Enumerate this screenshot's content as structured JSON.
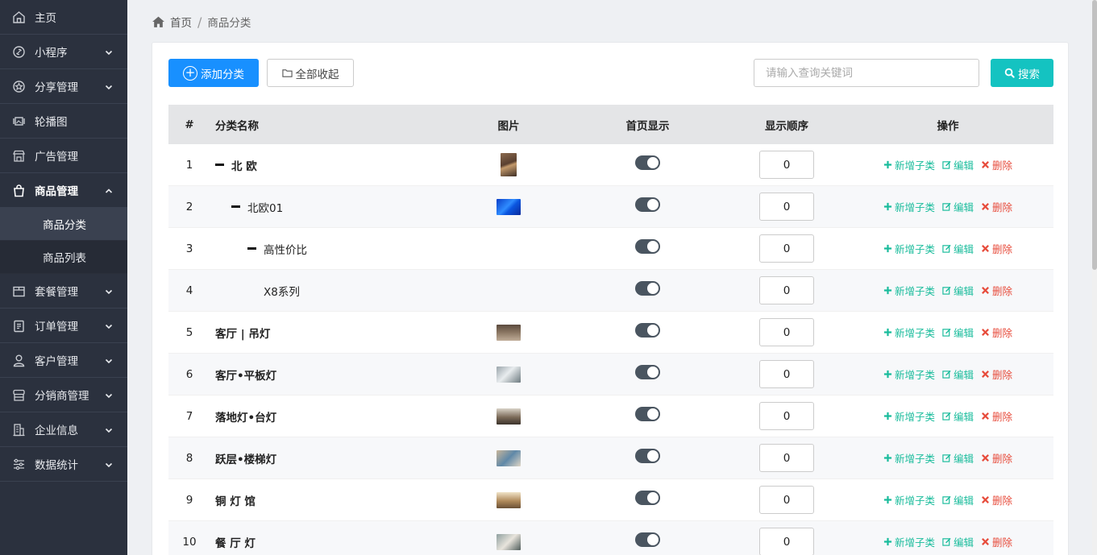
{
  "sidebar": {
    "items": [
      {
        "label": "主页",
        "icon": "home-icon",
        "has_chevron": false
      },
      {
        "label": "小程序",
        "icon": "link-icon",
        "has_chevron": true
      },
      {
        "label": "分享管理",
        "icon": "star-icon",
        "has_chevron": true
      },
      {
        "label": "轮播图",
        "icon": "carousel-icon",
        "has_chevron": false
      },
      {
        "label": "广告管理",
        "icon": "store-icon",
        "has_chevron": false
      },
      {
        "label": "商品管理",
        "icon": "bag-icon",
        "has_chevron": true,
        "expanded": true
      },
      {
        "label": "套餐管理",
        "icon": "box-icon",
        "has_chevron": true
      },
      {
        "label": "订单管理",
        "icon": "clipboard-icon",
        "has_chevron": true
      },
      {
        "label": "客户管理",
        "icon": "user-icon",
        "has_chevron": true
      },
      {
        "label": "分销商管理",
        "icon": "shop-icon",
        "has_chevron": true
      },
      {
        "label": "企业信息",
        "icon": "building-icon",
        "has_chevron": true
      },
      {
        "label": "数据统计",
        "icon": "sliders-icon",
        "has_chevron": true
      }
    ],
    "sub_items": [
      {
        "label": "商品分类",
        "selected": true
      },
      {
        "label": "商品列表",
        "selected": false
      }
    ]
  },
  "breadcrumb": {
    "home": "首页",
    "separator": "/",
    "current": "商品分类"
  },
  "toolbar": {
    "add_label": "添加分类",
    "collapse_label": "全部收起",
    "search_placeholder": "请输入查询关键词",
    "search_value": "",
    "search_label": "搜索"
  },
  "table": {
    "headers": {
      "idx": "#",
      "name": "分类名称",
      "image": "图片",
      "show": "首页显示",
      "order": "显示顺序",
      "ops": "操作"
    },
    "op_labels": {
      "add": "新增子类",
      "edit": "编辑",
      "delete": "删除"
    },
    "rows": [
      {
        "idx": "1",
        "name": "北 欧",
        "level": 0,
        "collapsible": true,
        "bold": true,
        "image": "tall-brown",
        "show_on_home": true,
        "order": "0"
      },
      {
        "idx": "2",
        "name": "北欧01",
        "level": 1,
        "collapsible": true,
        "bold": false,
        "image": "blue",
        "show_on_home": true,
        "order": "0"
      },
      {
        "idx": "3",
        "name": "高性价比",
        "level": 2,
        "collapsible": true,
        "bold": false,
        "image": "",
        "show_on_home": true,
        "order": "0"
      },
      {
        "idx": "4",
        "name": "X8系列",
        "level": 3,
        "collapsible": false,
        "bold": false,
        "image": "",
        "show_on_home": true,
        "order": "0"
      },
      {
        "idx": "5",
        "name": "客厅 | 吊灯",
        "level": 0,
        "collapsible": false,
        "bold": true,
        "image": "room-brown",
        "show_on_home": true,
        "order": "0"
      },
      {
        "idx": "6",
        "name": "客厅•平板灯",
        "level": 0,
        "collapsible": false,
        "bold": true,
        "image": "room-gray",
        "show_on_home": true,
        "order": "0"
      },
      {
        "idx": "7",
        "name": "落地灯•台灯",
        "level": 0,
        "collapsible": false,
        "bold": true,
        "image": "room-lamp",
        "show_on_home": true,
        "order": "0"
      },
      {
        "idx": "8",
        "name": "跃层•楼梯灯",
        "level": 0,
        "collapsible": false,
        "bold": true,
        "image": "room-stairs",
        "show_on_home": true,
        "order": "0"
      },
      {
        "idx": "9",
        "name": "铜 灯 馆",
        "level": 0,
        "collapsible": false,
        "bold": true,
        "image": "room-warm",
        "show_on_home": true,
        "order": "0"
      },
      {
        "idx": "10",
        "name": "餐 厅 灯",
        "level": 0,
        "collapsible": false,
        "bold": true,
        "image": "room-dining",
        "show_on_home": true,
        "order": "0"
      }
    ]
  },
  "colors": {
    "sidebar_bg": "#2b313e",
    "primary": "#1890ff",
    "search_btn": "#14c3c1",
    "op_green": "#1abc9c",
    "op_red": "#e74c3c"
  }
}
